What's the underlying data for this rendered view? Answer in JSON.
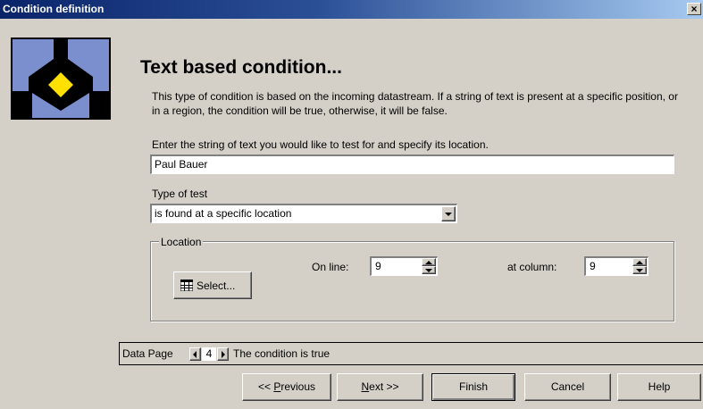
{
  "window": {
    "title": "Condition definition",
    "close_glyph": "×"
  },
  "logo": {
    "icon": "condition-logo-icon"
  },
  "heading": "Text based condition...",
  "description": "This type of condition is based on the incoming datastream. If a string of text is present at a specific position, or in a region, the condition will be true, otherwise, it will be false.",
  "search_text": {
    "label": "Enter the string of text you would like to test for and specify its location.",
    "value": "Paul Bauer"
  },
  "test_type": {
    "label": "Type of test",
    "selected": "is found at a specific location"
  },
  "location": {
    "legend": "Location",
    "select_button": "Select...",
    "line_label": "On line:",
    "line_value": "9",
    "column_label": "at column:",
    "column_value": "9"
  },
  "status": {
    "data_page_label": "Data Page",
    "page_number": "4",
    "message": "The condition is true"
  },
  "buttons": {
    "previous_prefix": "<< ",
    "previous_hotkey": "P",
    "previous_rest": "revious",
    "next_hotkey": "N",
    "next_rest": "ext >>",
    "finish": "Finish",
    "cancel": "Cancel",
    "help": "Help"
  }
}
